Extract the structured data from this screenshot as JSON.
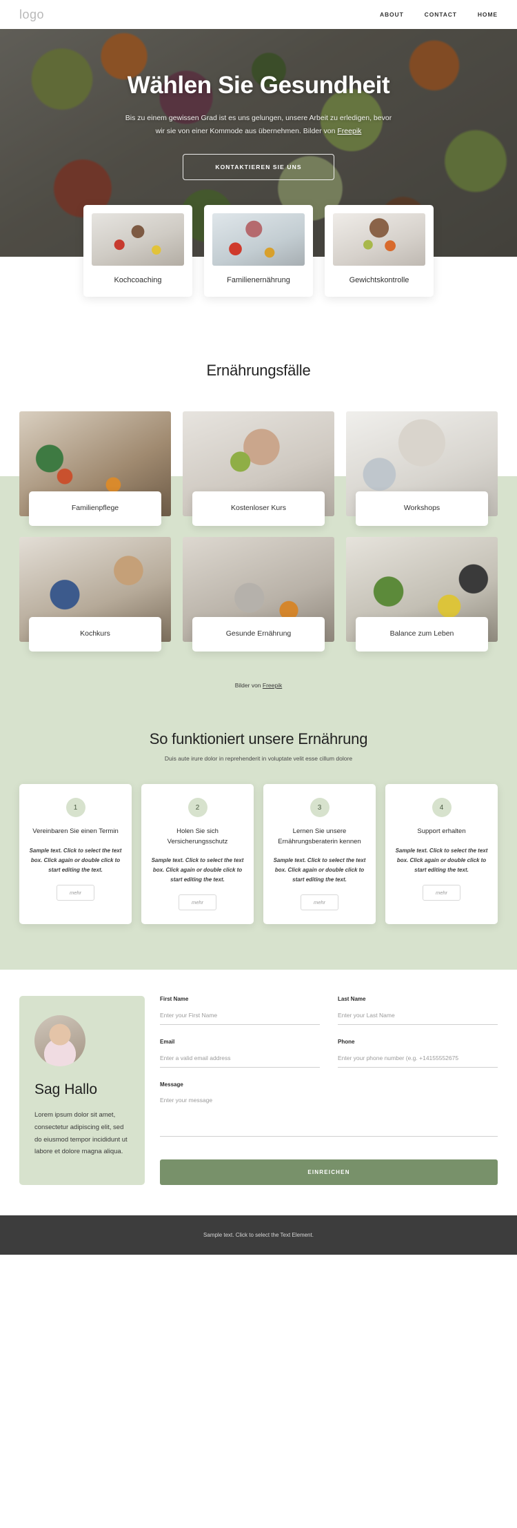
{
  "header": {
    "logo": "logo",
    "nav": [
      {
        "label": "ABOUT"
      },
      {
        "label": "CONTACT"
      },
      {
        "label": "HOME"
      }
    ]
  },
  "hero": {
    "title": "Wählen Sie Gesundheit",
    "subtitle_line1": "Bis zu einem gewissen Grad ist es uns gelungen, unsere Arbeit zu erledigen, bevor",
    "subtitle_line2": "wir sie von einer Kommode aus übernehmen. Bilder von ",
    "subtitle_link": "Freepik",
    "cta": "KONTAKTIEREN SIE UNS"
  },
  "services": [
    {
      "label": "Kochcoaching",
      "image": "woman-cooking-kitchen-image"
    },
    {
      "label": "Familienernährung",
      "image": "mother-child-kitchen-image"
    },
    {
      "label": "Gewichtskontrolle",
      "image": "woman-holding-fruit-image"
    }
  ],
  "cases": {
    "title": "Ernährungsfälle",
    "items": [
      {
        "label": "Familienpflege",
        "image": "family-meal-table-image"
      },
      {
        "label": "Kostenloser Kurs",
        "image": "woman-with-apple-image"
      },
      {
        "label": "Workshops",
        "image": "family-group-kitchen-image"
      },
      {
        "label": "Kochkurs",
        "image": "man-writing-notes-image"
      },
      {
        "label": "Gesunde Ernährung",
        "image": "woman-sofa-orange-image"
      },
      {
        "label": "Balance zum Leben",
        "image": "blender-smoothie-image"
      }
    ],
    "credit_prefix": "Bilder von ",
    "credit_link": "Freepik"
  },
  "process": {
    "title": "So funktioniert unsere Ernährung",
    "subtitle": "Duis aute irure dolor in reprehenderit in voluptate velit esse cillum dolore",
    "steps": [
      {
        "number": "1",
        "title": "Vereinbaren Sie einen Termin",
        "text": "Sample text. Click to select the text box. Click again or double click to start editing the text.",
        "button": "mehr"
      },
      {
        "number": "2",
        "title": "Holen Sie sich Versicherungsschutz",
        "text": "Sample text. Click to select the text box. Click again or double click to start editing the text.",
        "button": "mehr"
      },
      {
        "number": "3",
        "title": "Lernen Sie unsere Ernährungsberaterin kennen",
        "text": "Sample text. Click to select the text box. Click again or double click to start editing the text.",
        "button": "mehr"
      },
      {
        "number": "4",
        "title": "Support erhalten",
        "text": "Sample text. Click to select the text box. Click again or double click to start editing the text.",
        "button": "mehr"
      }
    ]
  },
  "contact": {
    "avatar": "woman-portrait-avatar",
    "heading": "Sag Hallo",
    "paragraph": "Lorem ipsum dolor sit amet, consectetur adipiscing elit, sed do eiusmod tempor incididunt ut labore et dolore magna aliqua.",
    "fields": {
      "first_name_label": "First Name",
      "first_name_placeholder": "Enter your First Name",
      "last_name_label": "Last Name",
      "last_name_placeholder": "Enter your Last Name",
      "email_label": "Email",
      "email_placeholder": "Enter a valid email address",
      "phone_label": "Phone",
      "phone_placeholder": "Enter your phone number (e.g. +14155552675",
      "message_label": "Message",
      "message_placeholder": "Enter your message"
    },
    "submit": "EINREICHEN"
  },
  "footer": {
    "text": "Sample text. Click to select the Text Element."
  },
  "colors": {
    "green_band": "#d7e2cd",
    "submit_button": "#78916a",
    "footer_bg": "#3d3d3d"
  }
}
